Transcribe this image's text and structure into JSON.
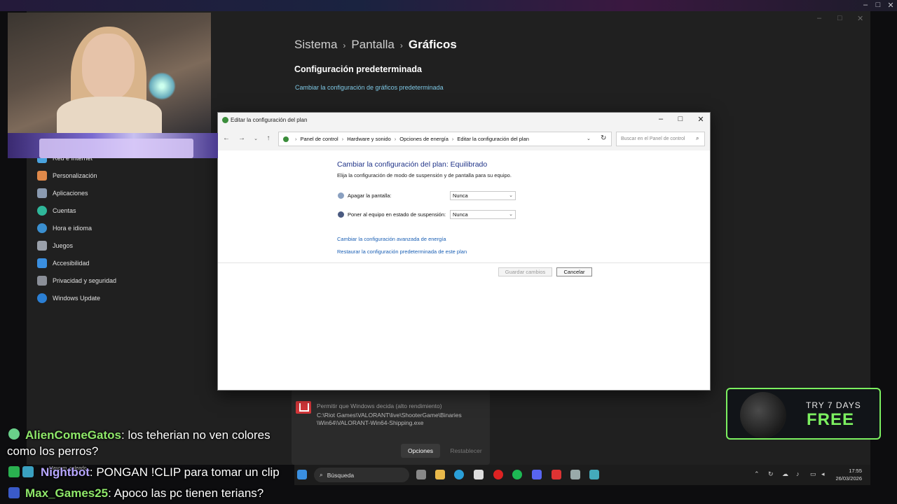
{
  "colors": {
    "accent": "#7cf060",
    "link": "#1a5fb4",
    "heading": "#1e3287"
  },
  "settings": {
    "breadcrumb": [
      "Sistema",
      "Pantalla",
      "Gráficos"
    ],
    "section_title": "Configuración predeterminada",
    "section_link": "Cambiar la configuración de gráficos predeterminada",
    "nav": [
      {
        "label": "Red e Internet",
        "icon": "wifi-icon"
      },
      {
        "label": "Personalización",
        "icon": "brush-icon"
      },
      {
        "label": "Aplicaciones",
        "icon": "apps-icon"
      },
      {
        "label": "Cuentas",
        "icon": "person-icon"
      },
      {
        "label": "Hora e idioma",
        "icon": "globe-clock-icon"
      },
      {
        "label": "Juegos",
        "icon": "gamepad-icon"
      },
      {
        "label": "Accesibilidad",
        "icon": "accessibility-icon"
      },
      {
        "label": "Privacidad y seguridad",
        "icon": "shield-icon"
      },
      {
        "label": "Windows Update",
        "icon": "update-icon"
      }
    ],
    "app_card": {
      "preference": "Permitir que Windows decida (alto rendimiento)",
      "path_line1": "C:\\Riot Games\\VALORANT\\live\\ShooterGame\\Binaries",
      "path_line2": "\\Win64\\VALORANT-Win64-Shipping.exe",
      "options_label": "Opciones",
      "reset_label": "Restablecer"
    }
  },
  "dialog": {
    "title": "Editar la configuración del plan",
    "address": [
      "Panel de control",
      "Hardware y sonido",
      "Opciones de energía",
      "Editar la configuración del plan"
    ],
    "search_placeholder": "Buscar en el Panel de control",
    "heading": "Cambiar la configuración del plan: Equilibrado",
    "subheading": "Elija la configuración de modo de suspensión y de pantalla para su equipo.",
    "options": [
      {
        "label": "Apagar la pantalla:",
        "value": "Nunca",
        "icon": "monitor-icon"
      },
      {
        "label": "Poner al equipo en estado de suspensión:",
        "value": "Nunca",
        "icon": "moon-icon"
      }
    ],
    "link_advanced": "Cambiar la configuración avanzada de energía",
    "link_restore": "Restaurar la configuración predeterminada de este plan",
    "save_label": "Guardar cambios",
    "cancel_label": "Cancelar"
  },
  "promo": {
    "top": "TRY 7 DAYS",
    "main": "FREE"
  },
  "chat": [
    {
      "user": "AlienComeGatos",
      "message": "los teherian no ven colores",
      "message_cont": "como los perros?"
    },
    {
      "user": "Nightbot",
      "message": "PONGAN !CLIP para tomar un clip"
    },
    {
      "user": "Max_Games25",
      "message": "Apoco las pc tienen terians?"
    }
  ],
  "taskbar": {
    "search_placeholder": "Búsqueda",
    "weather": "Mayorm. soleado",
    "time": "17:55",
    "date": "26/03/2026"
  }
}
